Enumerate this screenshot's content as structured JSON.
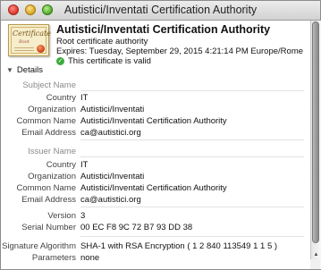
{
  "window": {
    "title": "Autistici/Inventati Certification Authority"
  },
  "header": {
    "name": "Autistici/Inventati Certification Authority",
    "kind": "Root certificate authority",
    "expires": "Expires: Tuesday, September 29, 2015 4:21:14 PM Europe/Rome",
    "validity": "This certificate is valid",
    "icon_text": "Certificate",
    "icon_sub": "Root"
  },
  "details": {
    "label": "Details"
  },
  "subject": {
    "title": "Subject Name",
    "rows": [
      {
        "label": "Country",
        "value": "IT"
      },
      {
        "label": "Organization",
        "value": "Autistici/Inventati"
      },
      {
        "label": "Common Name",
        "value": "Autistici/Inventati Certification Authority"
      },
      {
        "label": "Email Address",
        "value": "ca@autistici.org"
      }
    ]
  },
  "issuer": {
    "title": "Issuer Name",
    "rows": [
      {
        "label": "Country",
        "value": "IT"
      },
      {
        "label": "Organization",
        "value": "Autistici/Inventati"
      },
      {
        "label": "Common Name",
        "value": "Autistici/Inventati Certification Authority"
      },
      {
        "label": "Email Address",
        "value": "ca@autistici.org"
      }
    ]
  },
  "meta": {
    "rows": [
      {
        "label": "Version",
        "value": "3"
      },
      {
        "label": "Serial Number",
        "value": "00 EC F8 9C 72 B7 93 DD 38"
      }
    ]
  },
  "signature": {
    "rows": [
      {
        "label": "Signature Algorithm",
        "value": "SHA-1 with RSA Encryption ( 1 2 840 113549 1 1 5 )"
      },
      {
        "label": "Parameters",
        "value": "none"
      }
    ]
  },
  "colors": {
    "valid": "#3cab3c",
    "section_label": "#8a8a8a"
  }
}
